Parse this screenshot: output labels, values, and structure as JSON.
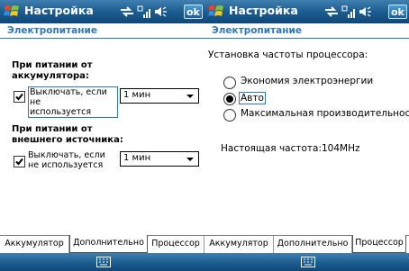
{
  "colors": {
    "titlebar": "#1f5f92",
    "header_text": "#2f78b8",
    "focus": "#2f78b8"
  },
  "screens": [
    {
      "title": "Настройка",
      "ok_label": "ok",
      "header": "Электропитание",
      "battery": {
        "heading_1": "При питании от",
        "heading_2": "аккумулятора:",
        "checkbox_line1": "Выключать, если не",
        "checkbox_line2": "используется",
        "checked": true,
        "select_value": "1 мин"
      },
      "external": {
        "heading_1": "При питании от",
        "heading_2": "внешнего источника:",
        "checkbox_line1": "Выключать, если",
        "checkbox_line2": "не используется",
        "checked": true,
        "select_value": "1 мин"
      },
      "tabs": [
        "Аккумулятор",
        "Дополнительно",
        "Процессор"
      ],
      "active_tab": 1
    },
    {
      "title": "Настройка",
      "ok_label": "ok",
      "header": "Электропитание",
      "cpu_label": "Установка частоты процессора:",
      "options": [
        "Экономия электроэнергии",
        "Авто",
        "Максимальная производительность"
      ],
      "selected_option": 1,
      "current_freq": "Настоящая частота:104MHz",
      "tabs": [
        "Аккумулятор",
        "Дополнительно",
        "Процессор"
      ],
      "active_tab": 2
    }
  ]
}
